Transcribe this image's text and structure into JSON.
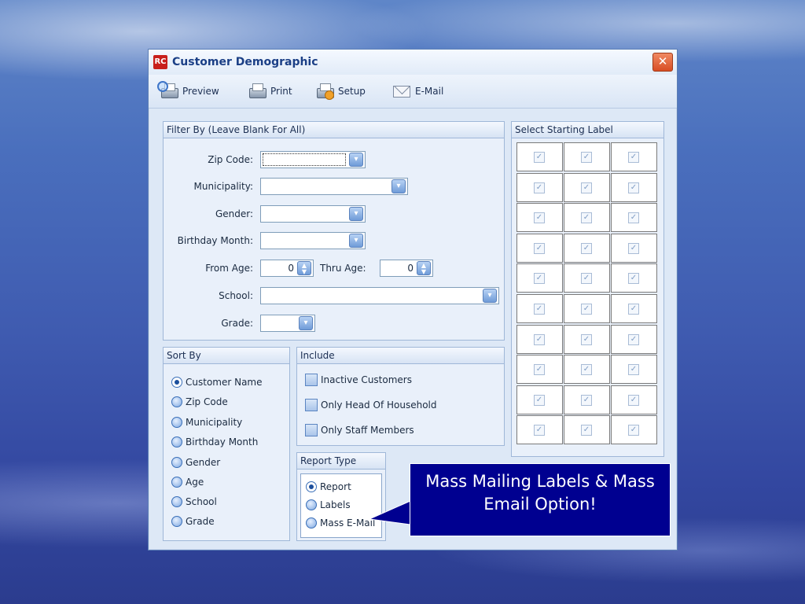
{
  "window": {
    "app_icon_text": "RC",
    "title": "Customer Demographic",
    "close_glyph": "✕"
  },
  "toolbar": {
    "preview_label": "Preview",
    "print_label": "Print",
    "setup_label": "Setup",
    "email_label": "E-Mail"
  },
  "filter": {
    "header": "Filter By (Leave Blank For All)",
    "zip_label": "Zip Code:",
    "zip_value": "",
    "municipality_label": "Municipality:",
    "municipality_value": "",
    "gender_label": "Gender:",
    "gender_value": "",
    "birthday_label": "Birthday Month:",
    "birthday_value": "",
    "from_age_label": "From Age:",
    "from_age_value": "0",
    "thru_age_label": "Thru Age:",
    "thru_age_value": "0",
    "school_label": "School:",
    "school_value": "",
    "grade_label": "Grade:",
    "grade_value": ""
  },
  "sort": {
    "header": "Sort By",
    "options": [
      "Customer Name",
      "Zip Code",
      "Municipality",
      "Birthday Month",
      "Gender",
      "Age",
      "School",
      "Grade"
    ],
    "selected": "Customer Name"
  },
  "include": {
    "header": "Include",
    "options": [
      "Inactive Customers",
      "Only Head Of Household",
      "Only Staff Members"
    ]
  },
  "report_type": {
    "header": "Report Type",
    "options": [
      "Report",
      "Labels",
      "Mass E-Mail"
    ],
    "selected": "Report"
  },
  "labels": {
    "header": "Select Starting Label",
    "rows": 10,
    "cols": 3,
    "check_glyph": "✓"
  },
  "callout": {
    "text": "Mass Mailing Labels & Mass Email Option!"
  },
  "icons": {
    "dropdown_glyph": "▾",
    "spin_up": "▲",
    "spin_down": "▼"
  }
}
